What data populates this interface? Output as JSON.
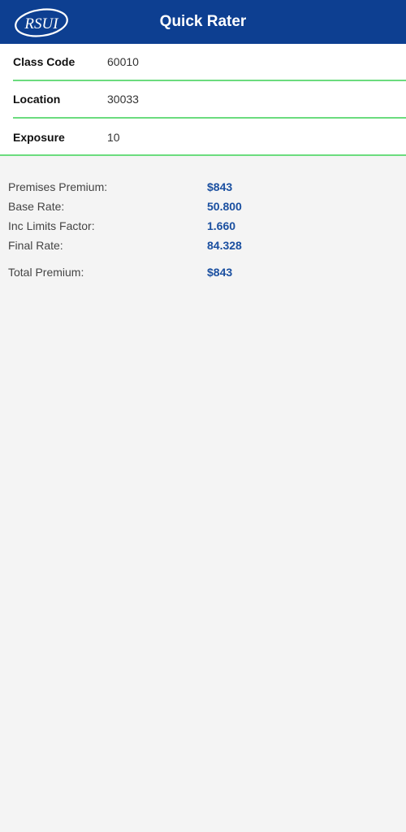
{
  "header": {
    "logo_text": "RSUI",
    "title": "Quick Rater",
    "brand_color": "#0d3f91"
  },
  "form": {
    "accent_color": "#6bdc7e",
    "rows": [
      {
        "label": "Class Code",
        "value": "60010"
      },
      {
        "label": "Location",
        "value": "30033"
      },
      {
        "label": "Exposure",
        "value": "10"
      }
    ]
  },
  "results": {
    "value_color": "#1a4fa0",
    "rows": [
      {
        "label": "Premises Premium:",
        "value": "$843"
      },
      {
        "label": "Base Rate:",
        "value": "50.800"
      },
      {
        "label": "Inc Limits Factor:",
        "value": "1.660"
      },
      {
        "label": "Final Rate:",
        "value": "84.328"
      }
    ],
    "total": {
      "label": "Total Premium:",
      "value": "$843"
    }
  }
}
